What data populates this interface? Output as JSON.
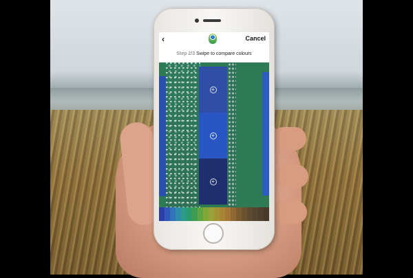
{
  "app": {
    "back_icon": "chevron-left-icon",
    "logo": "app-logo-icon",
    "cancel_label": "Cancel",
    "step_prefix": "Step 2/3",
    "step_text": "Swipe to compare colours"
  },
  "swatches": [
    {
      "color": "#2f4fa6",
      "icon": "plus-circle-icon"
    },
    {
      "color": "#2a56c4",
      "icon": "plus-circle-icon"
    },
    {
      "color": "#1f2f6e",
      "icon": "plus-circle-icon"
    }
  ],
  "colour_scale": [
    "#2c3fa8",
    "#2f58b8",
    "#2f73b8",
    "#2f8ca8",
    "#2c9b8a",
    "#2e9a6a",
    "#3e9e4f",
    "#5ea43f",
    "#7fa83b",
    "#98a13a",
    "#a59437",
    "#a88436",
    "#a57634",
    "#8e6832",
    "#7a5c31",
    "#6b5230",
    "#5e4a30",
    "#55452f",
    "#4d3f2c",
    "#473a29"
  ]
}
